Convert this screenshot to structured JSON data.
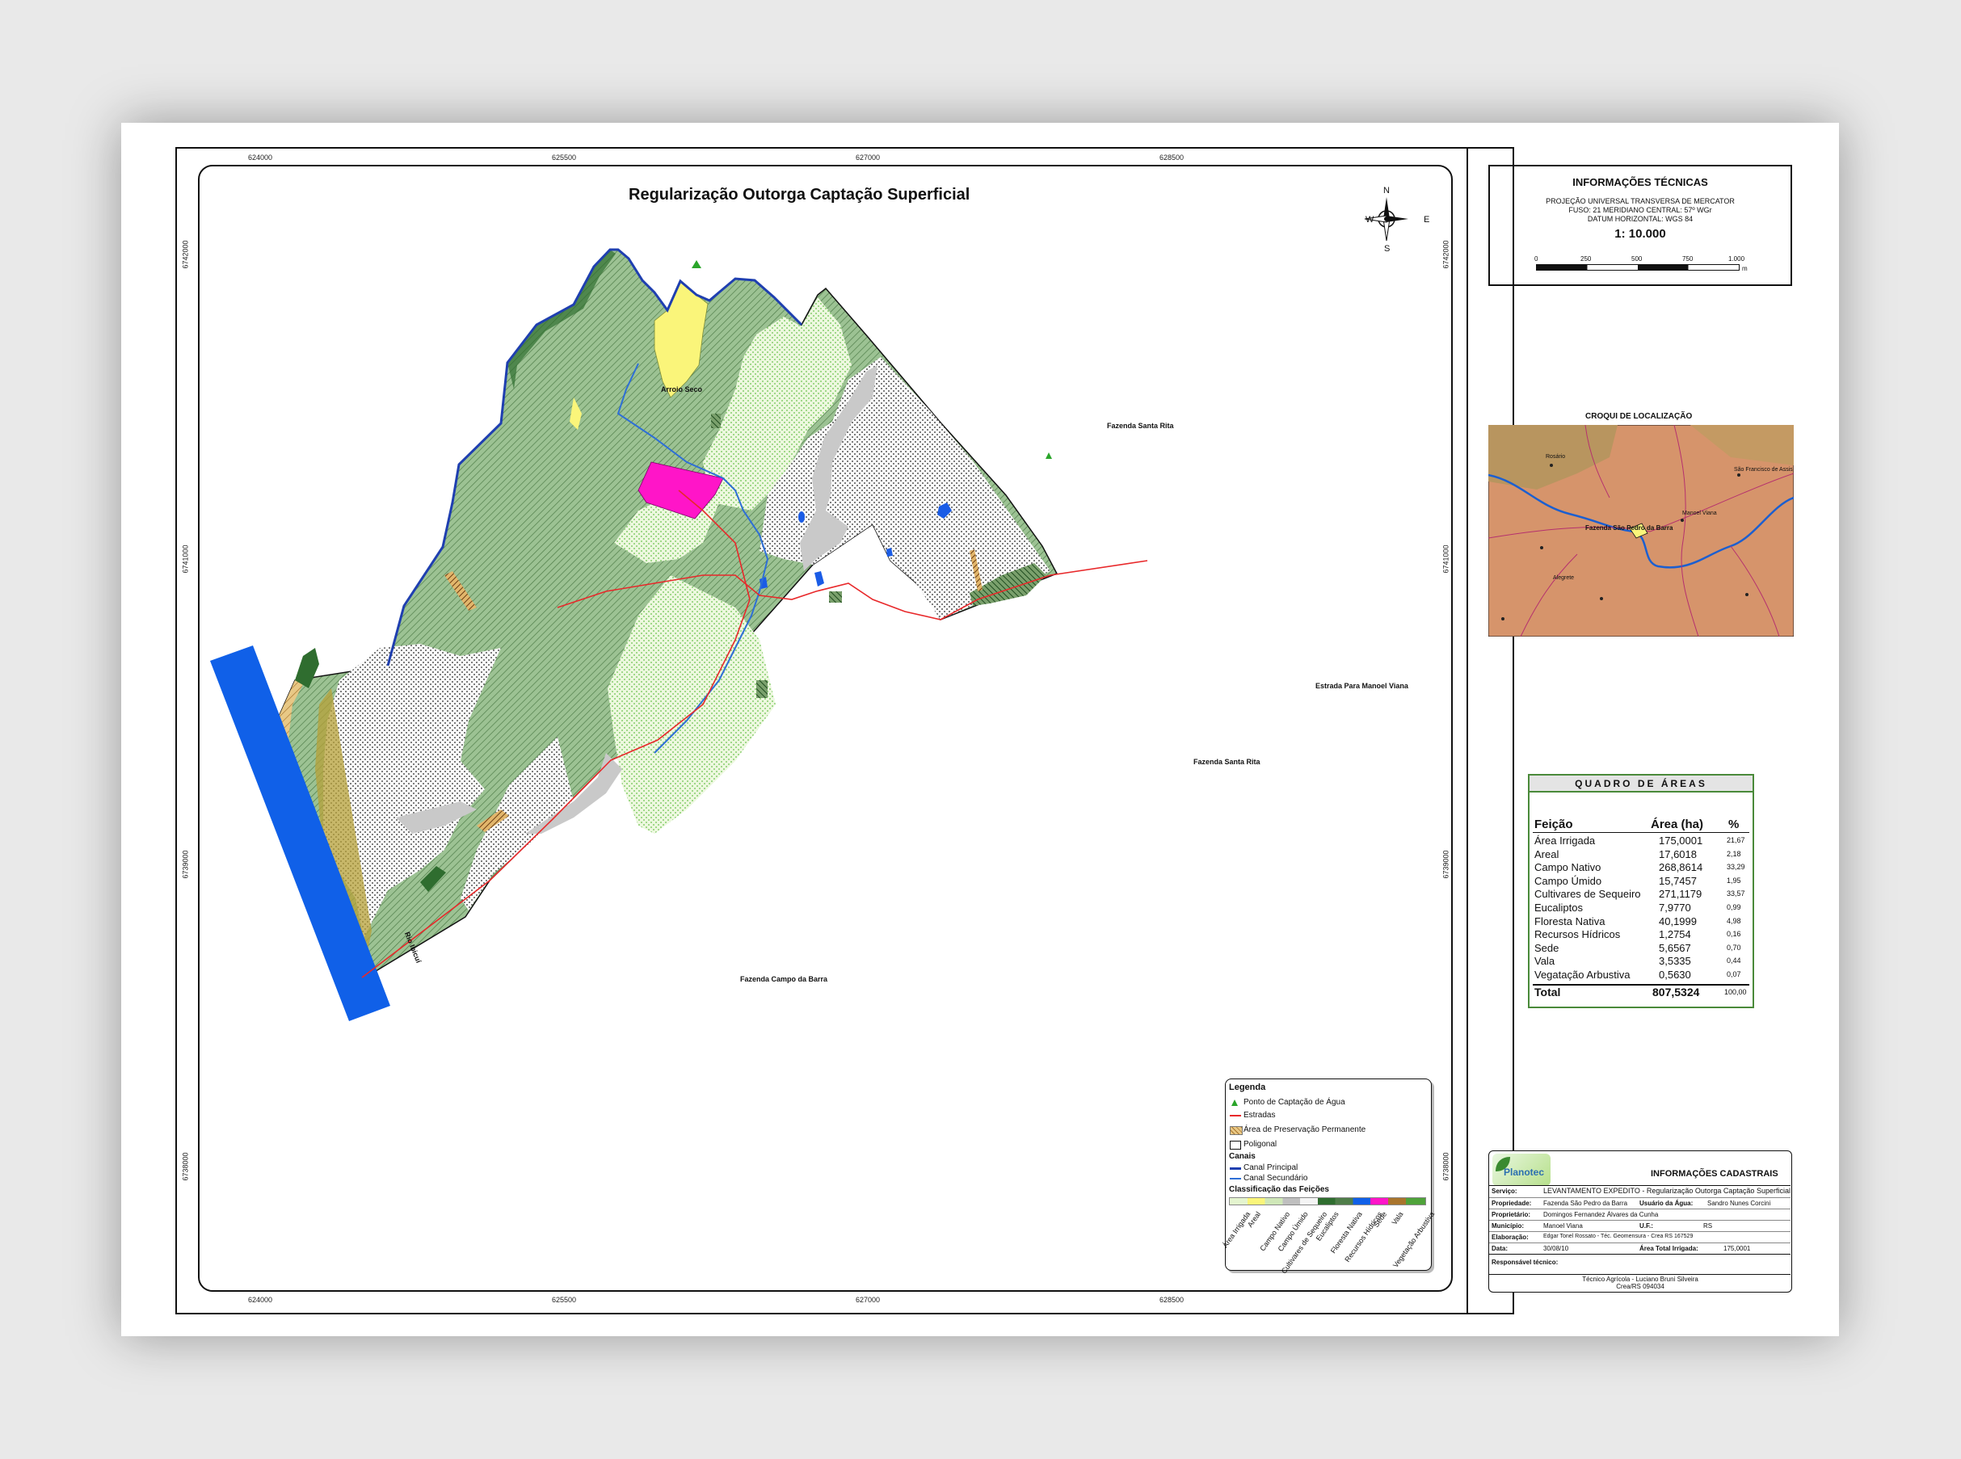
{
  "map": {
    "title": "Regularização Outorga Captação Superficial",
    "compass": {
      "n": "N",
      "s": "S",
      "e": "E",
      "w": "W"
    },
    "x_coords": [
      "624000",
      "625500",
      "627000",
      "628500"
    ],
    "y_coords": [
      "6742000",
      "6741000",
      "6739000",
      "6738000"
    ],
    "labels": {
      "arroio": "Arroio Seco",
      "santa_rita_1": "Fazenda Santa Rita",
      "santa_rita_2": "Fazenda Santa Rita",
      "estrada": "Estrada Para Manoel Viana",
      "campo_barra": "Fazenda Campo da Barra",
      "rio": "Rio Ibicuí"
    }
  },
  "tech": {
    "title": "INFORMAÇÕES TÉCNICAS",
    "line1": "PROJEÇÃO UNIVERSAL TRANSVERSA DE MERCATOR",
    "line2": "FUSO: 21   MERIDIANO CENTRAL: 57º WGr",
    "line3": "DATUM HORIZONTAL: WGS 84",
    "scale": "1: 10.000",
    "scale_ticks": [
      "0",
      "250",
      "500",
      "750",
      "1.000"
    ],
    "scale_unit": "m"
  },
  "croqui": {
    "title": "CROQUI DE LOCALIZAÇÃO",
    "places": [
      "Rosário",
      "São Francisco de Assis",
      "Manoel Viana",
      "Fazenda São Pedro da Barra",
      "Alegrete"
    ]
  },
  "quadro": {
    "title": "QUADRO DE ÁREAS",
    "headers": [
      "Feição",
      "Área (ha)",
      "%"
    ],
    "rows": [
      [
        "Área Irrigada",
        "175,0001",
        "21,67"
      ],
      [
        "Areal",
        "17,6018",
        "2,18"
      ],
      [
        "Campo Nativo",
        "268,8614",
        "33,29"
      ],
      [
        "Campo Úmido",
        "15,7457",
        "1,95"
      ],
      [
        "Cultivares de Sequeiro",
        "271,1179",
        "33,57"
      ],
      [
        "Eucaliptos",
        "7,9770",
        "0,99"
      ],
      [
        "Floresta Nativa",
        "40,1999",
        "4,98"
      ],
      [
        "Recursos Hídricos",
        "1,2754",
        "0,16"
      ],
      [
        "Sede",
        "5,6567",
        "0,70"
      ],
      [
        "Vala",
        "3,5335",
        "0,44"
      ],
      [
        "Vegatação Arbustiva",
        "0,5630",
        "0,07"
      ]
    ],
    "total": [
      "Total",
      "807,5324",
      "100,00"
    ]
  },
  "legend": {
    "title": "Legenda",
    "ponto": "Ponto de Captação de Água",
    "estradas": "Estradas",
    "app": "Área de Preservação Permanente",
    "poligonal": "Poligonal",
    "canais": "Canais",
    "canal_principal": "Canal Principal",
    "canal_secundario": "Canal Secundário",
    "classificacao": "Classificação das Feições",
    "classes": [
      "Área Irrigada",
      "Areal",
      "Campo Nativo",
      "Campo Úmido",
      "Cultivares de Sequeiro",
      "Eucaliptos",
      "Floresta Nativa",
      "Recursos Hídricos",
      "Sede",
      "Vala",
      "Vegetação Arbustiva"
    ]
  },
  "cadastrais": {
    "title": "INFORMAÇÕES CADASTRAIS",
    "logo_text": "Planotec",
    "servico_label": "Serviço:",
    "servico": "LEVANTAMENTO EXPEDITO - Regularização Outorga Captação Superficial",
    "propriedade_label": "Propriedade:",
    "propriedade": "Fazenda São Pedro da Barra",
    "usuario_label": "Usuário da Água:",
    "usuario": "Sandro Nunes Corcini",
    "proprietario_label": "Proprietário:",
    "proprietario": "Domingos Fernandez Álvares da Cunha",
    "municipio_label": "Município:",
    "municipio": "Manoel Viana",
    "uf_label": "U.F.:",
    "uf": "RS",
    "elaboracao_label": "Elaboração:",
    "elaboracao": "Edgar Tonel Rossato - Téc. Geomensura - Crea RS 167529",
    "data_label": "Data:",
    "data": "30/08/10",
    "area_label": "Área Total Irrigada:",
    "area": "175,0001",
    "resp_label": "Responsável técnico:",
    "resp_name": "Técnico Agrícola - Luciano Bruni Silveira",
    "resp_crea": "Crea/RS 094034"
  },
  "colors": {
    "floresta": "#93b98a",
    "irrigada_bg": "#e4f4cf",
    "irrigada_dot": "#7fce62",
    "areal": "#faf57a",
    "rio": "#1060e8",
    "sede": "#ff15c8",
    "estrada": "#e8282a",
    "canal": "#2860d8",
    "app": "#e6c27a",
    "eucalipto": "#2f6d2f"
  }
}
